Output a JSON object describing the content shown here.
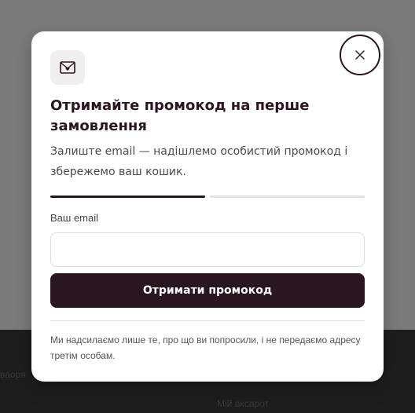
{
  "background": {
    "footer_left_text": "ваоря",
    "footer_bottom_text": "Мій аксарот"
  },
  "modal": {
    "icon": "envelope-heart-icon",
    "close_icon": "close-icon",
    "title": "Отримайте промокод на перше замовлення",
    "subtitle": "Залиште email — надішлемо особистий промокод і збережемо ваш кошик.",
    "progress": {
      "step": 1,
      "total_steps": 2
    },
    "email_label": "Ваш email",
    "email_value": "",
    "email_placeholder": "",
    "submit_label": "Отримати промокод",
    "disclaimer": "Ми надсилаємо лише те, про що ви попросили, і не передаємо адресу третім особам."
  },
  "colors": {
    "accent": "#2a1620",
    "overlay": "#7b7b7b"
  }
}
